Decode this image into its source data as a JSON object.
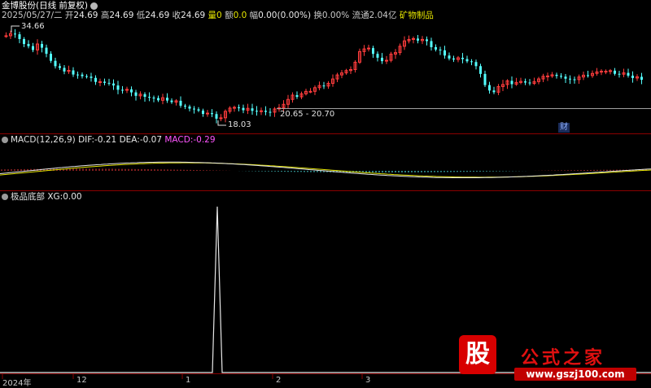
{
  "header": {
    "name_period": "金博股份(日线 前复权)",
    "date": "2025/05/27/二",
    "open_label": "开",
    "open": "24.69",
    "high_label": "高",
    "high": "24.69",
    "low_label": "低",
    "low": "24.69",
    "close_label": "收",
    "close": "24.69",
    "vol_label": "量",
    "vol": "0",
    "amount_label": "额",
    "amount": "0.0",
    "change_label": "幅",
    "change": "0.00(0.00%)",
    "turnover_label": "换",
    "turnover": "0.00%",
    "float_label": "流通",
    "float": "2.04亿",
    "sector": "矿物制品"
  },
  "price_annotations": {
    "high_mark": "34.66",
    "low_mark": "18.03",
    "range_label": "20.65 - 20.70",
    "cai_badge": "财"
  },
  "macd_panel": {
    "title": "MACD(12,26,9)",
    "dif_label": "DIF:",
    "dif": "-0.21",
    "dea_label": "DEA:",
    "dea": "-0.07",
    "macd_label": "MACD:",
    "macd": "-0.29"
  },
  "indicator_panel": {
    "title": "极品底部",
    "xg_label": "XG:",
    "xg": "0.00",
    "spike_index": 62
  },
  "x_axis": {
    "labels": [
      "2024年",
      "12",
      "1",
      "2",
      "3"
    ]
  },
  "watermark": {
    "badge": "股",
    "title": "公式之家",
    "url": "www.gszj100.com"
  },
  "colors": {
    "up": "#ff3c3c",
    "down": "#54ffff",
    "dif": "#e8e8e8",
    "dea": "#e6e600",
    "macd_text": "#ff55ff",
    "separator": "#8b0000"
  }
}
